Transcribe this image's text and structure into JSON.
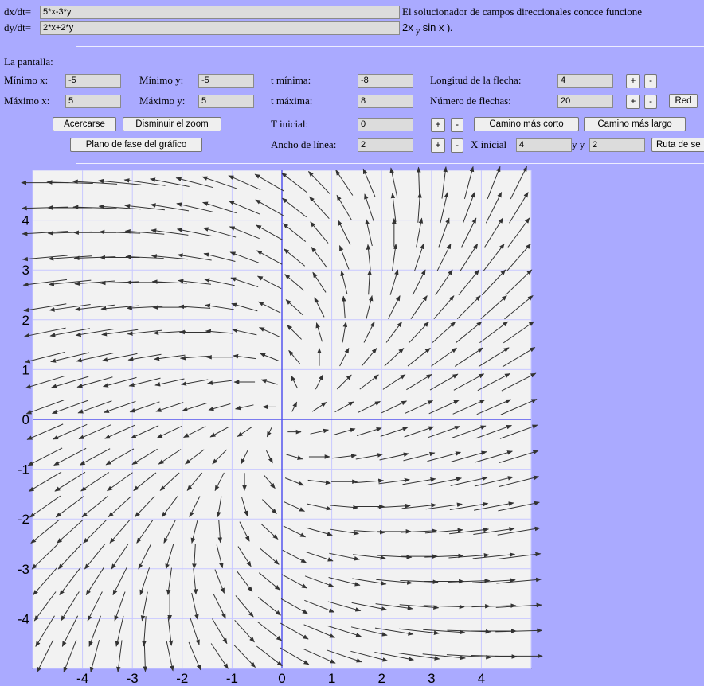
{
  "equations": {
    "dx_label": "dx/dt=",
    "dx_value": "5*x-3*y",
    "dy_label": "dy/dt=",
    "dy_value": "2*x+2*y",
    "info_line1": "El solucionador de campos direccionales conoce funcione",
    "info_line2_a": "2x",
    "info_line2_b": "y",
    "info_line2_c": "sin x",
    "info_line2_d": ")."
  },
  "screen": {
    "heading": "La pantalla:",
    "min_x_label": "Mínimo x:",
    "min_x": "-5",
    "max_x_label": "Máximo x:",
    "max_x": "5",
    "min_y_label": "Mínimo y:",
    "min_y": "-5",
    "max_y_label": "Máximo y:",
    "max_y": "5",
    "zoom_in": "Acercarse",
    "zoom_out": "Disminuir el zoom",
    "phase_plane": "Plano de fase del gráfico"
  },
  "time": {
    "t_min_label": "t mínima:",
    "t_min": "-8",
    "t_max_label": "t máxima:",
    "t_max": "8",
    "t_init_label": "T inicial:",
    "t_init": "0",
    "line_width_label": "Ancho de línea:",
    "line_width": "2"
  },
  "arrows": {
    "length_label": "Longitud de la flecha:",
    "length": "4",
    "count_label": "Número de flechas:",
    "count": "20",
    "plus": "+",
    "minus": "-",
    "grid_button": "Red",
    "shorter_path": "Camino más corto",
    "longer_path": "Camino más largo",
    "x_init_label": "X inicial",
    "x_init": "4",
    "y_init_label": "y y",
    "y_init": "2",
    "route_button": "Ruta de se"
  },
  "chart_data": {
    "type": "vector-field",
    "equations": {
      "dx_dt": "5*x-3*y",
      "dy_dt": "2*x+2*y"
    },
    "xlim": [
      -5,
      5
    ],
    "ylim": [
      -5,
      5
    ],
    "x_ticks": [
      "-4",
      "-3",
      "-2",
      "-1",
      "0",
      "1",
      "2",
      "3",
      "4"
    ],
    "y_ticks": [
      "4",
      "3",
      "2",
      "1",
      "0",
      "-1",
      "-2",
      "-3",
      "-4"
    ],
    "arrows_per_axis": 20,
    "grid": true,
    "colors": {
      "background": "#aaaaff",
      "plot": "#f2f2f2",
      "grid": "#c8c8ff",
      "axes": "#5555ee",
      "arrow": "#333333"
    }
  }
}
